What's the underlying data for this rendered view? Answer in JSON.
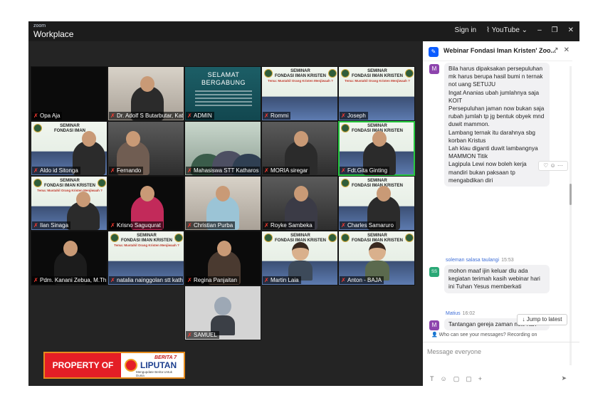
{
  "titlebar": {
    "brand_top": "zoom",
    "brand_main": "Workplace",
    "sign_in": "Sign in",
    "youtube": "YouTube",
    "minimize": "–",
    "restore": "❐",
    "close": "✕"
  },
  "tiles": [
    {
      "name": "Opa Aja"
    },
    {
      "name": "Dr. Adolf S Butarbutar, Kat..."
    },
    {
      "name": "ADMIN",
      "title_line1": "SELAMAT",
      "title_line2": "BERGABUNG"
    },
    {
      "name": "Rommi",
      "seminar": "SEMINAR",
      "seminar2": "FONDASI IMAN KRISTEN"
    },
    {
      "name": "Joseph",
      "seminar": "SEMINAR",
      "seminar2": "FONDASI IMAN KRISTEN"
    },
    {
      "name": "Aldo id Sitonga",
      "seminar": "SEMINAR",
      "seminar2": "FONDASI IMAN"
    },
    {
      "name": "Fernando"
    },
    {
      "name": "Mahasiswa STT Katharos"
    },
    {
      "name": "MORIA siregar"
    },
    {
      "name": "Fdt.Gita Ginting",
      "seminar": "SEMINAR",
      "seminar2": "FONDASI IMAN KRISTEN"
    },
    {
      "name": "Ilan Sinaga",
      "seminar": "SEMINAR",
      "seminar2": "FONDASI IMAN KRISTEN"
    },
    {
      "name": "Krisno Saguqurat"
    },
    {
      "name": "Christian Purba"
    },
    {
      "name": "Royke Sambeka"
    },
    {
      "name": "Charles Samaruro",
      "seminar": "SEMINAR",
      "seminar2": "FONDASI IMAN KRISTEN"
    },
    {
      "name": "Pdm. Kanani Zebua, M.Th"
    },
    {
      "name": "natalia nainggolan stt kath...",
      "seminar": "SEMINAR",
      "seminar2": "FONDASI IMAN KRISTEN"
    },
    {
      "name": "Regina Panjaitan"
    },
    {
      "name": "Martin Laia",
      "seminar": "SEMINAR",
      "seminar2": "FONDASI IMAN KRISTEN"
    },
    {
      "name": "Anton - BAJA",
      "seminar": "SEMINAR",
      "seminar2": "FONDASI IMAN KRISTEN"
    },
    {
      "name": "SAMUEL"
    }
  ],
  "seminar_subtitle": "Tema: Mustahil Orang Kristen Menjiwaah ?",
  "property": {
    "label": "PROPERTY OF",
    "brand_top": "BERITA 7",
    "brand_main": "LIPUTAN",
    "brand_sub": "Mengupdate Berita Untuk Dunia"
  },
  "chat": {
    "title": "Webinar Fondasi Iman Kristen' Zoo...",
    "header_more": "···",
    "header_popout": "↗",
    "header_close": "✕",
    "msg1": {
      "avatar": "M",
      "lines": [
        "Bila harus dipaksakan persepuluhan mk harus berupa hasil bumi n ternak not uang SETUJU",
        "Ingat Ananias ubah jumlahnya saja KOIT",
        "Persepuluhan jaman now bukan saja rubah jumlah tp jg bentuk obyek mnd duwit mammon.",
        "Lambang ternak itu darahnya sbg korban Kristus",
        "Lah klau diganti duwit lambangnya MAMMON Titik",
        "Lagipula Lewi now boleh kerja mandiri bukan paksaan tp mengabdikan diri"
      ]
    },
    "reaction": "♡ ☺ ···",
    "msg2": {
      "avatar": "SS",
      "sender": "soleman salasa taulangi",
      "time": "15:53",
      "text": "mohon maaf ijin keluar dlu ada kegiatan terimah kasih webinar hari ini Tuhan Yesus memberkati"
    },
    "msg3": {
      "avatar": "M",
      "sender": "Matius",
      "time": "16:02",
      "text": "Tantangan gereja zaman now hari"
    },
    "jump_label": "↓ Jump to latest",
    "who_can_see": "Who can see your messages? Recording on",
    "compose_placeholder": "Message everyone",
    "tools": [
      "T",
      "☺",
      "▢",
      "▢",
      "+"
    ],
    "send": "➤"
  }
}
